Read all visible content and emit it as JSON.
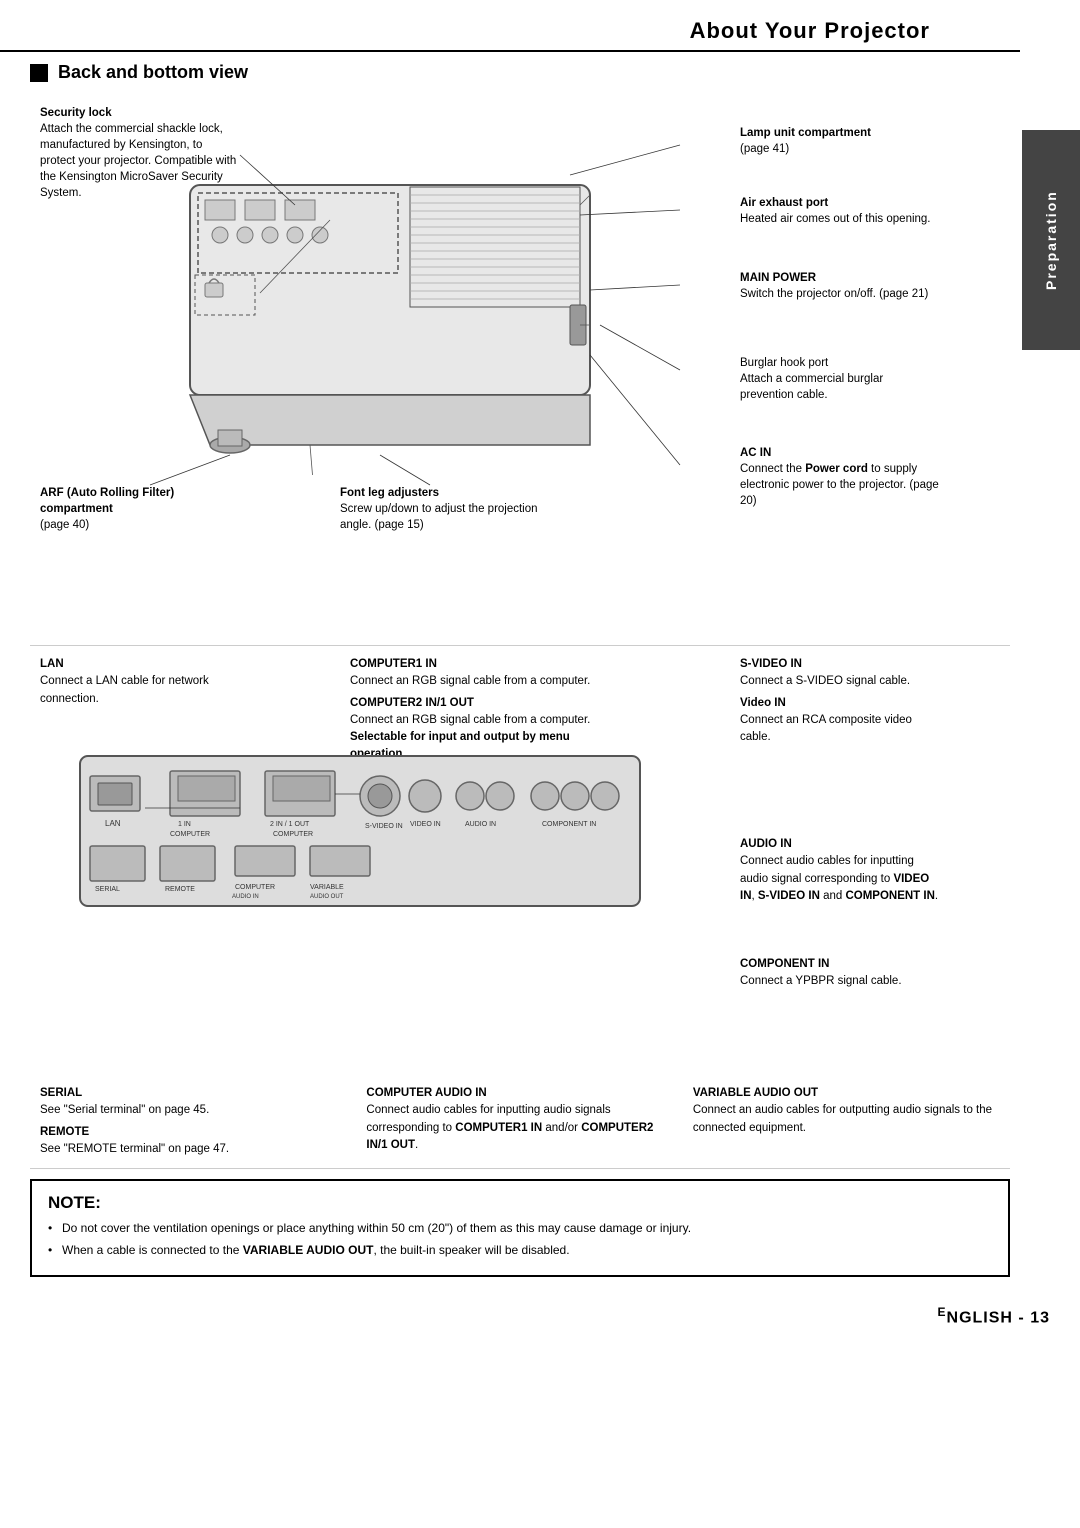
{
  "page": {
    "title": "About Your Projector",
    "tab_label": "Preparation",
    "footer": "ENGLISH - 13",
    "section_heading": "Back and bottom view"
  },
  "annotations_top_left": {
    "security_lock": {
      "label": "Security lock",
      "text": "Attach the commercial shackle lock, manufactured by Kensington, to protect your projector. Compatible with the Kensington MicroSaver Security System."
    },
    "arf": {
      "label": "ARF (Auto Rolling Filter) compartment",
      "text": "(page 40)"
    },
    "font_leg": {
      "label": "Font leg adjusters",
      "text": "Screw up/down to adjust the projection angle. (page 15)"
    }
  },
  "annotations_top_right": {
    "lamp": {
      "label": "Lamp unit compartment",
      "text": "(page 41)"
    },
    "air_exhaust": {
      "label": "Air exhaust port",
      "text": "Heated air comes out of this opening."
    },
    "main_power": {
      "label": "MAIN POWER",
      "text": "Switch the projector on/off. (page 21)"
    },
    "burglar": {
      "label": "Burglar hook port",
      "text": "Attach a commercial burglar prevention cable."
    },
    "ac_in": {
      "label": "AC IN",
      "text": "Connect the Power cord to supply electronic power to the projector. (page 20)"
    }
  },
  "annotations_connector": {
    "lan": {
      "label": "LAN",
      "text": "Connect a LAN cable for network connection."
    },
    "computer1": {
      "label": "COMPUTER1 IN",
      "text": "Connect an RGB signal cable from a computer.",
      "label2": "COMPUTER2 IN/1 OUT",
      "text2": "Connect an RGB signal cable from a computer. Selectable for input and output by menu operation."
    },
    "svideo": {
      "label": "S-VIDEO IN",
      "text": "Connect a S-VIDEO signal cable.",
      "label2": "Video IN",
      "text2": "Connect an RCA composite video cable."
    },
    "audio_in": {
      "label": "AUDIO IN",
      "text": "Connect audio cables for inputting audio signal corresponding to VIDEO IN, S-VIDEO IN and COMPONENT IN."
    },
    "component": {
      "label": "COMPONENT IN",
      "text": "Connect a YPBPR signal cable."
    }
  },
  "annotations_bottom": {
    "serial": {
      "label": "SERIAL",
      "text": "See \"Serial terminal\" on page 45.",
      "label2": "REMOTE",
      "text2": "See \"REMOTE terminal\" on page 47."
    },
    "computer_audio_in": {
      "label": "COMPUTER AUDIO IN",
      "text": "Connect audio cables for inputting audio signals corresponding to COMPUTER1 IN and/or COMPUTER2 IN/1 OUT."
    },
    "variable_audio_out": {
      "label": "VARIABLE AUDIO OUT",
      "text": "Connect an audio cables for outputting audio signals to the connected equipment."
    }
  },
  "note": {
    "title": "NOTE:",
    "items": [
      "Do not cover the ventilation openings or place anything within 50 cm (20\") of them as this may cause damage or injury.",
      "When a cable is connected to the VARIABLE AUDIO OUT, the built-in speaker will be disabled."
    ]
  }
}
